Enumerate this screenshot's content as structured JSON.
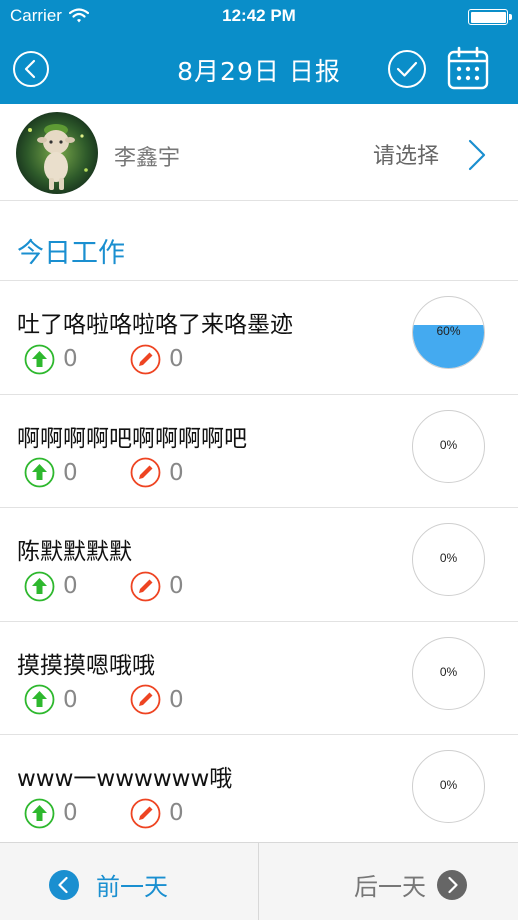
{
  "status_bar": {
    "carrier": "Carrier",
    "time": "12:42 PM"
  },
  "nav": {
    "title": "8月29日 日报"
  },
  "profile": {
    "name": "李鑫宇",
    "select_label": "请选择"
  },
  "section": {
    "title": "今日工作"
  },
  "tasks": [
    {
      "title": "吐了咯啦咯啦咯了来咯墨迹",
      "up_count": "0",
      "edit_count": "0",
      "progress": 0.6,
      "progress_label": "60%"
    },
    {
      "title": "啊啊啊啊吧啊啊啊啊吧",
      "up_count": "0",
      "edit_count": "0",
      "progress": 0,
      "progress_label": "0%"
    },
    {
      "title": "陈默默默默",
      "up_count": "0",
      "edit_count": "0",
      "progress": 0,
      "progress_label": "0%"
    },
    {
      "title": "摸摸摸嗯哦哦",
      "up_count": "0",
      "edit_count": "0",
      "progress": 0,
      "progress_label": "0%"
    },
    {
      "title": "www一wwwwww哦",
      "up_count": "0",
      "edit_count": "0",
      "progress": 0,
      "progress_label": "0%"
    }
  ],
  "bottom": {
    "prev_label": "前一天",
    "next_label": "后一天"
  },
  "icons": {
    "up": "arrow-up-circle-icon",
    "edit": "pencil-circle-icon",
    "back": "chevron-left-circle-icon",
    "confirm": "checkmark-circle-icon",
    "calendar": "calendar-icon"
  },
  "colors": {
    "brand": "#0a8ec9",
    "accent": "#1a8fd0",
    "progress": "#44aaf0",
    "up": "#2eb82e",
    "edit": "#ee4422"
  }
}
